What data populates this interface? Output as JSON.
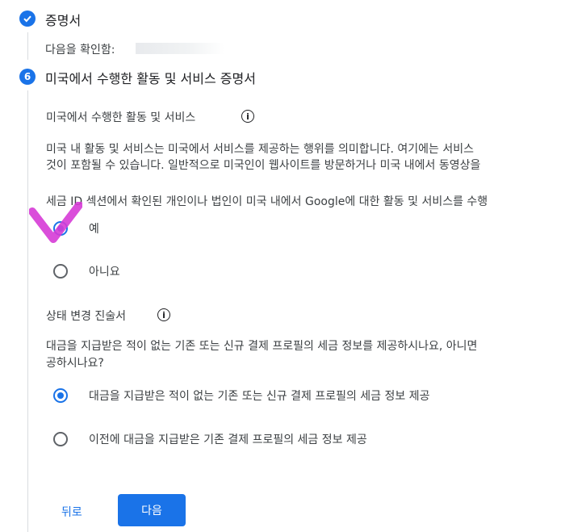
{
  "step_cert": {
    "title": "증명서",
    "verify_label": "다음을 확인함:"
  },
  "step6": {
    "number": "6",
    "title": "미국에서 수행한 활동 및 서비스 증명서"
  },
  "activities": {
    "heading": "미국에서 수행한 활동 및 서비스",
    "description_line1": "미국 내 활동 및 서비스는 미국에서 서비스를 제공하는 행위를 의미합니다. 여기에는 서비스",
    "description_line2": "것이 포함될 수 있습니다. 일반적으로 미국인이 웹사이트를 방문하거나 미국 내에서 동영상을",
    "question": "세금 ID 섹션에서 확인된 개인이나 법인이 미국 내에서 Google에 대한 활동 및 서비스를 수행",
    "options": [
      "예",
      "아니요"
    ],
    "selected": "예"
  },
  "status_change": {
    "heading": "상태 변경 진술서",
    "question_line1": "대금을 지급받은 적이 없는 기존 또는 신규 결제 프로필의 세금 정보를 제공하시나요, 아니면",
    "question_line2": "공하시나요?",
    "options": [
      "대금을 지급받은 적이 없는 기존 또는 신규 결제 프로필의 세금 정보 제공",
      "이전에 대금을 지급받은 기존 결제 프로필의 세금 정보 제공"
    ],
    "selected": "대금을 지급받은 적이 없는 기존 또는 신규 결제 프로필의 세금 정보 제공"
  },
  "buttons": {
    "back": "뒤로",
    "next": "다음"
  },
  "colors": {
    "accent": "#1a73e8",
    "annotation": "#d63bd6"
  },
  "icons": {
    "completed": "check-circle-icon",
    "info": "info-icon",
    "annotation": "checkmark-annotation-icon"
  }
}
